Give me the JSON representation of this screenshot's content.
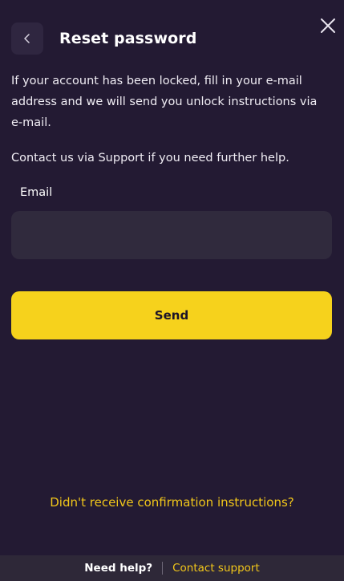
{
  "modal": {
    "title": "Reset password",
    "description_1": "If your account has been locked, fill in your e-mail address and we will send you unlock instructions via e-mail.",
    "description_2": "Contact us via Support if you need further help.",
    "email_label": "Email",
    "email_value": "",
    "send_label": "Send",
    "confirmation_link": "Didn't receive confirmation instructions?"
  },
  "footer": {
    "help_text": "Need help?",
    "contact_link": "Contact support"
  },
  "icons": {
    "back": "chevron-left-icon",
    "close": "close-icon"
  },
  "colors": {
    "background": "#231a33",
    "input_bg": "#302a3d",
    "accent": "#f6d21c",
    "link": "#f1c61a",
    "footer_bg": "#2e2838"
  }
}
